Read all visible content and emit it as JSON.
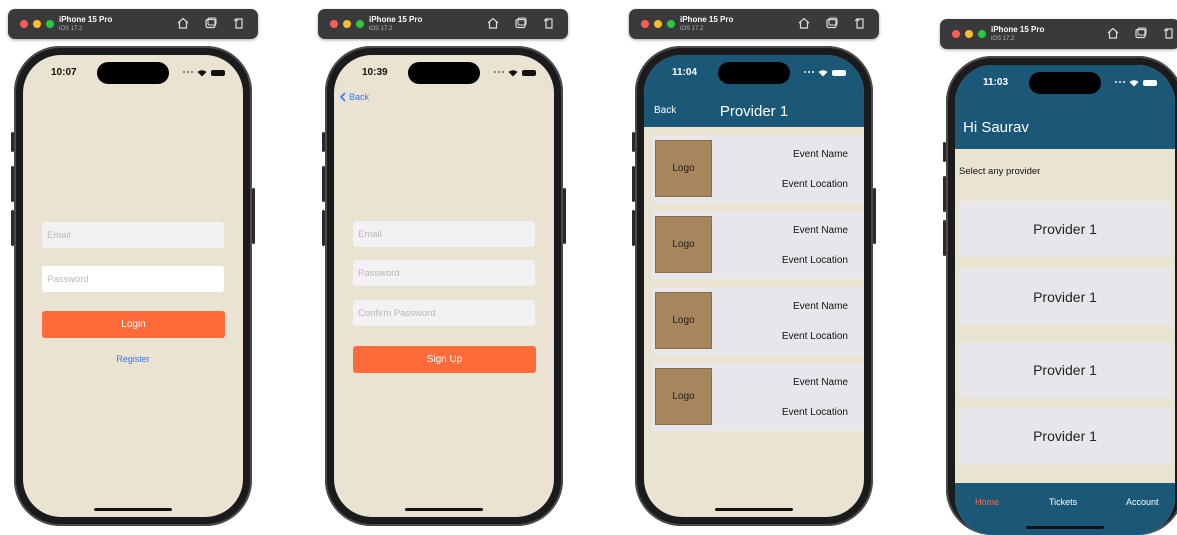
{
  "simulator": {
    "device": "iPhone 15 Pro",
    "os": "iOS 17.2"
  },
  "screens": {
    "login": {
      "time": "10:07",
      "email_placeholder": "Email",
      "password_placeholder": "Password",
      "login_label": "Login",
      "register_label": "Register"
    },
    "signup": {
      "time": "10:39",
      "back_label": "Back",
      "email_placeholder": "Email",
      "password_placeholder": "Password",
      "confirm_placeholder": "Confirm Password",
      "signup_label": "Sign Up"
    },
    "provider": {
      "time": "11:04",
      "back_label": "Back",
      "title": "Provider 1",
      "events": [
        {
          "logo": "Logo",
          "name": "Event Name",
          "location": "Event Location"
        },
        {
          "logo": "Logo",
          "name": "Event Name",
          "location": "Event Location"
        },
        {
          "logo": "Logo",
          "name": "Event Name",
          "location": "Event Location"
        },
        {
          "logo": "Logo",
          "name": "Event Name",
          "location": "Event Location"
        }
      ]
    },
    "home": {
      "time": "11:03",
      "greeting": "Hi Saurav",
      "select_label": "Select any provider",
      "providers": [
        "Provider 1",
        "Provider 1",
        "Provider 1",
        "Provider 1"
      ],
      "tabs": [
        "Home",
        "Tickets",
        "Account"
      ]
    }
  },
  "colors": {
    "background": "#ebe3d1",
    "accent": "#fe6b3b",
    "nav": "#1b5878",
    "link": "#2f7bf5",
    "logo_box": "#a8865d"
  },
  "icons": [
    "home-icon",
    "screenshot-icon",
    "rotate-icon",
    "wifi-icon",
    "battery-icon",
    "chevron-left-icon"
  ]
}
